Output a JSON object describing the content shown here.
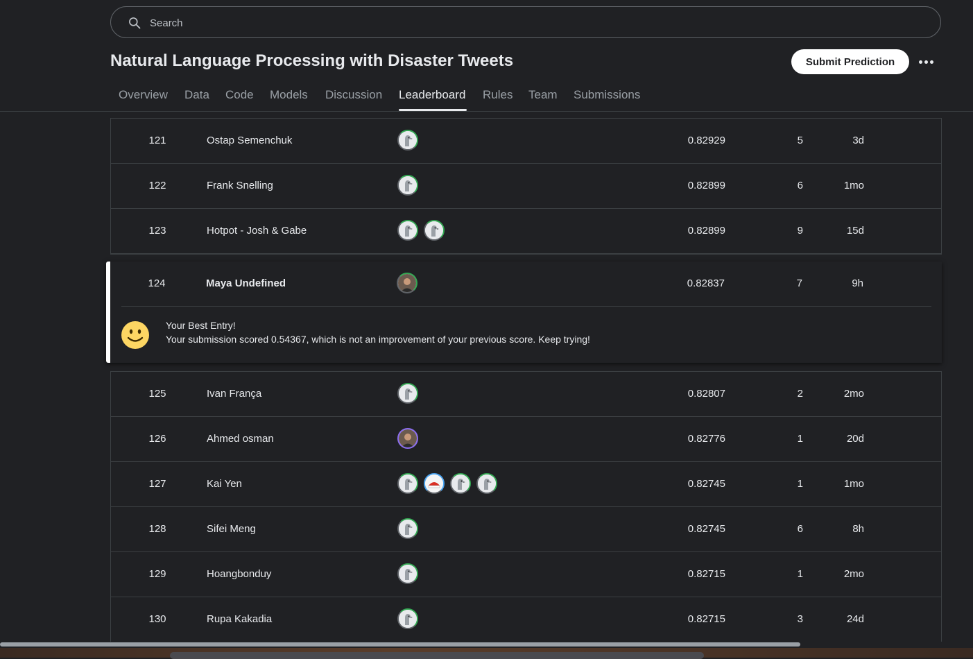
{
  "search": {
    "placeholder": "Search"
  },
  "competition": {
    "title": "Natural Language Processing with Disaster Tweets"
  },
  "actions": {
    "submit_label": "Submit Prediction"
  },
  "tabs": [
    {
      "label": "Overview"
    },
    {
      "label": "Data"
    },
    {
      "label": "Code"
    },
    {
      "label": "Models"
    },
    {
      "label": "Discussion"
    },
    {
      "label": "Leaderboard",
      "active": true
    },
    {
      "label": "Rules"
    },
    {
      "label": "Team"
    },
    {
      "label": "Submissions"
    }
  ],
  "rows_before": [
    {
      "rank": "121",
      "name": "Ostap Semenchuk",
      "score": "0.82929",
      "entries": "5",
      "last": "3d",
      "avatars": [
        "default-avatar-icon"
      ]
    },
    {
      "rank": "122",
      "name": "Frank Snelling",
      "score": "0.82899",
      "entries": "6",
      "last": "1mo",
      "avatars": [
        "default-avatar-icon"
      ]
    },
    {
      "rank": "123",
      "name": "Hotpot - Josh & Gabe",
      "score": "0.82899",
      "entries": "9",
      "last": "15d",
      "avatars": [
        "default-avatar-icon",
        "default-avatar-icon"
      ]
    }
  ],
  "my_entry": {
    "rank": "124",
    "name": "Maya Undefined",
    "score": "0.82837",
    "entries": "7",
    "last": "9h",
    "avatars": [
      "user-photo-avatar"
    ],
    "message_title": "Your Best Entry!",
    "message_body": "Your submission scored 0.54367, which is not an improvement of your previous score. Keep trying!"
  },
  "rows_after": [
    {
      "rank": "125",
      "name": "Ivan França",
      "score": "0.82807",
      "entries": "2",
      "last": "2mo",
      "avatars": [
        "default-avatar-icon"
      ]
    },
    {
      "rank": "126",
      "name": "Ahmed osman",
      "score": "0.82776",
      "entries": "1",
      "last": "20d",
      "avatars": [
        "user-photo-avatar"
      ]
    },
    {
      "rank": "127",
      "name": "Kai Yen",
      "score": "0.82745",
      "entries": "1",
      "last": "1mo",
      "avatars": [
        "default-avatar-icon",
        "custom-avatar-icon",
        "default-avatar-icon",
        "default-avatar-icon"
      ]
    },
    {
      "rank": "128",
      "name": "Sifei Meng",
      "score": "0.82745",
      "entries": "6",
      "last": "8h",
      "avatars": [
        "default-avatar-icon"
      ]
    },
    {
      "rank": "129",
      "name": "Hoangbonduy",
      "score": "0.82715",
      "entries": "1",
      "last": "2mo",
      "avatars": [
        "default-avatar-icon"
      ]
    },
    {
      "rank": "130",
      "name": "Rupa Kakadia",
      "score": "0.82715",
      "entries": "3",
      "last": "24d",
      "avatars": [
        "default-avatar-icon"
      ]
    }
  ],
  "colors": {
    "background": "#202124",
    "text": "#e8eaed",
    "muted": "#9aa0a6",
    "border": "#3c4043",
    "tier_green": "#34a853",
    "smiley": "#fdd663"
  }
}
